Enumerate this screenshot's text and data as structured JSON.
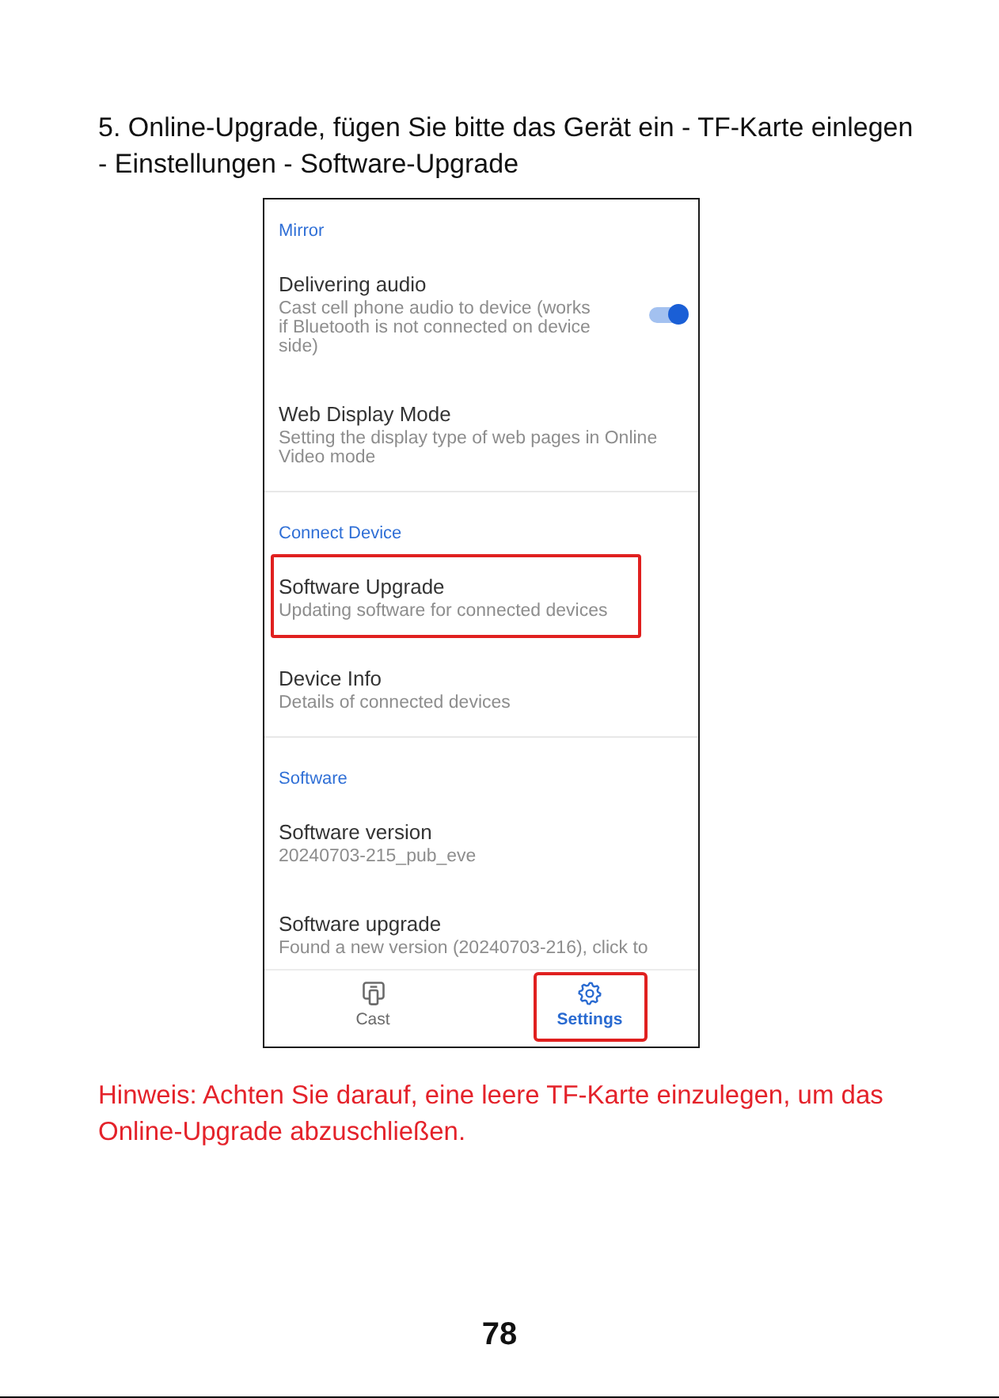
{
  "instruction": "5. Online-Upgrade, fügen Sie bitte das Gerät ein - TF-Karte einlegen - Einstellungen - Software-Upgrade",
  "phone_screen": {
    "sections": [
      {
        "header": "Mirror",
        "items": [
          {
            "kind": "toggle",
            "title": "Delivering audio",
            "description": "Cast cell phone audio to device (works if Bluetooth is not connected on device side)",
            "on": true,
            "highlighted": false
          },
          {
            "kind": "text",
            "title": "Web Display Mode",
            "description": "Setting the display type of web pages in Online Video mode",
            "highlighted": false
          }
        ]
      },
      {
        "header": "Connect Device",
        "items": [
          {
            "kind": "text",
            "title": "Software Upgrade",
            "description": "Updating software for connected devices",
            "highlighted": true
          },
          {
            "kind": "text",
            "title": "Device Info",
            "description": "Details of connected devices",
            "highlighted": false
          }
        ]
      },
      {
        "header": "Software",
        "items": [
          {
            "kind": "text",
            "title": "Software version",
            "description": "20240703-215_pub_eve",
            "highlighted": false
          },
          {
            "kind": "text",
            "title": "Software upgrade",
            "description": "Found a new version (20240703-216), click to",
            "highlighted": false
          }
        ]
      }
    ],
    "bottom_nav": [
      {
        "label": "Cast",
        "selected": false,
        "highlighted": false
      },
      {
        "label": "Settings",
        "selected": true,
        "highlighted": true
      }
    ]
  },
  "note": "Hinweis: Achten Sie darauf, eine leere TF-Karte einzulegen, um das Online-Upgrade abzuschließen.",
  "page_number": "78"
}
